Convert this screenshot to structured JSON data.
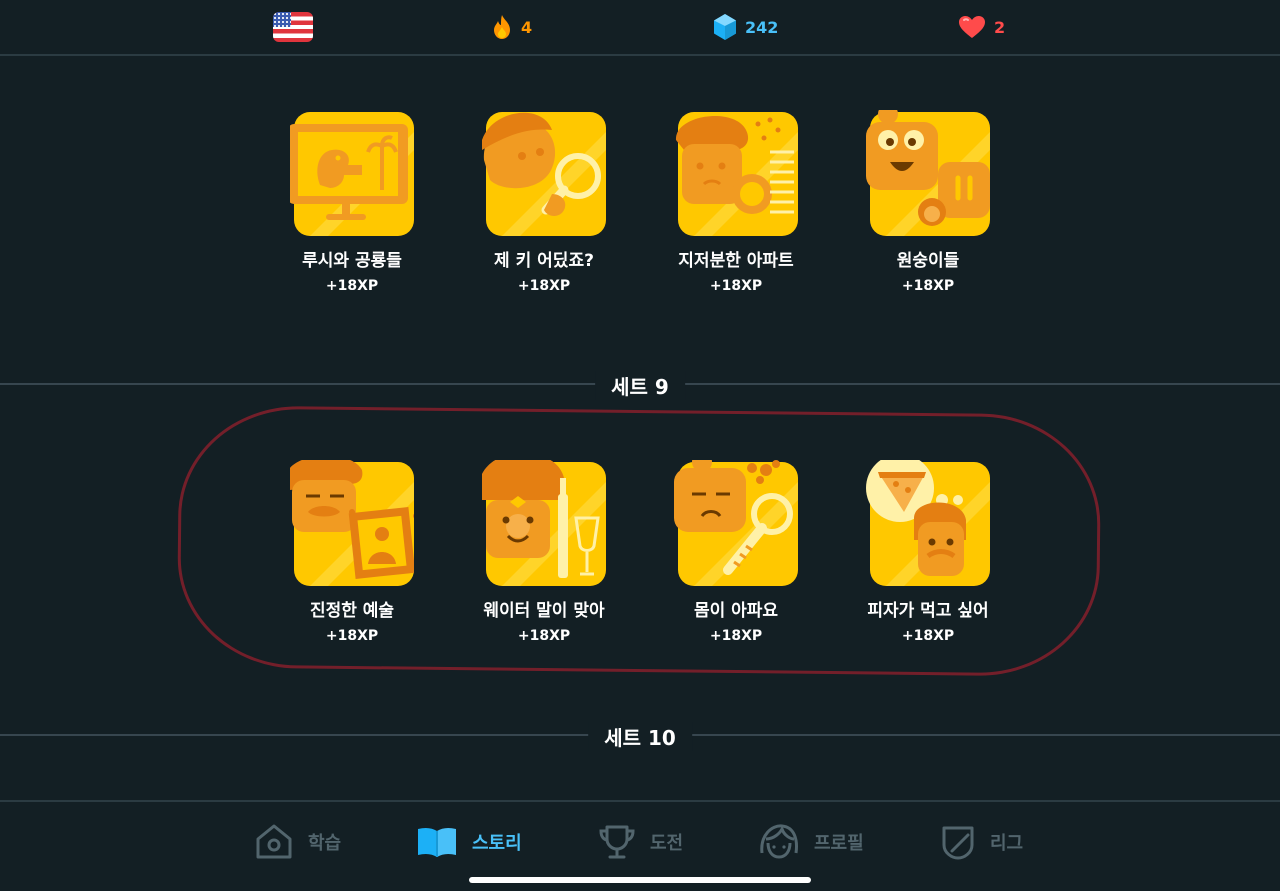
{
  "status_bar": {
    "course_flag": "us-flag-icon",
    "streak": "4",
    "gems": "242",
    "hearts": "2",
    "colors": {
      "streak": "#ff9600",
      "gems": "#49c0f8",
      "hearts": "#ff4b4b"
    }
  },
  "stories_row_1": [
    {
      "title": "루시와 공룡들",
      "xp": "+18XP",
      "icon": "dinosaur-painting-icon"
    },
    {
      "title": "제 키 어딨죠?",
      "xp": "+18XP",
      "icon": "magnifier-search-icon"
    },
    {
      "title": "지저분한 아파트",
      "xp": "+18XP",
      "icon": "messy-apartment-icon"
    },
    {
      "title": "원숭이들",
      "xp": "+18XP",
      "icon": "monkeys-icon"
    }
  ],
  "sets": [
    {
      "label": "세트 9"
    },
    {
      "label": "세트 10"
    }
  ],
  "stories_row_2": [
    {
      "title": "진정한 예술",
      "xp": "+18XP",
      "icon": "mona-lisa-icon"
    },
    {
      "title": "웨이터 말이 맞아",
      "xp": "+18XP",
      "icon": "waiter-wine-icon"
    },
    {
      "title": "몸이 아파요",
      "xp": "+18XP",
      "icon": "thermometer-icon"
    },
    {
      "title": "피자가 먹고 싶어",
      "xp": "+18XP",
      "icon": "pizza-thought-icon"
    }
  ],
  "bottom_nav": [
    {
      "label": "학습",
      "icon": "home-icon",
      "active": false
    },
    {
      "label": "스토리",
      "icon": "book-icon",
      "active": true
    },
    {
      "label": "도전",
      "icon": "trophy-icon",
      "active": false
    },
    {
      "label": "프로필",
      "icon": "profile-icon",
      "active": false
    },
    {
      "label": "리그",
      "icon": "shield-icon",
      "active": false
    }
  ],
  "colors": {
    "background": "#131f24",
    "tile_gold": "#ffc800",
    "tile_orange": "#f19b22",
    "nav_active": "#49c0f8",
    "nav_inactive": "#52656d",
    "highlight": "#7e1f2b"
  }
}
